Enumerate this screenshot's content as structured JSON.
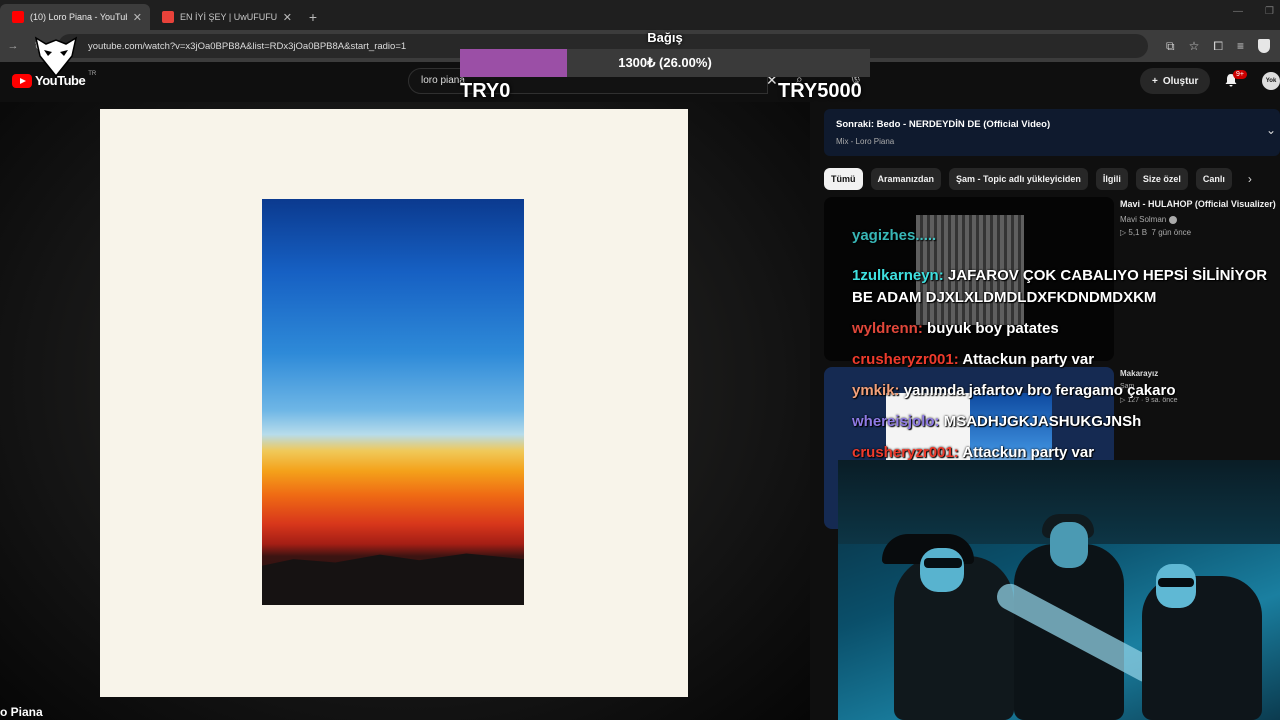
{
  "browser": {
    "tabs": [
      {
        "title": "(10) Loro Piana - YouTube",
        "active": true,
        "favicon_color": "#ff0000"
      },
      {
        "title": "EN İYİ ŞEY | UwUFUFU",
        "active": false,
        "favicon_color": "#e8423a"
      }
    ],
    "url": "youtube.com/watch?v=x3jOa0BPB8A&list=RDx3jOa0BPB8A&start_radio=1"
  },
  "youtube": {
    "logo_text": "YouTube",
    "country": "TR",
    "search_value": "loro piana",
    "create_label": "Oluştur",
    "notif_badge": "9+",
    "avatar_text": "Yok"
  },
  "donation": {
    "title": "Bağış",
    "amount_text": "1300₺ (26.00%)",
    "progress_fraction": 0.26,
    "min_label": "TRY0",
    "max_label": "TRY5000",
    "bar_color": "#9b4fa6"
  },
  "video": {
    "channel_name_partial": "o Piana"
  },
  "up_next": {
    "title": "Sonraki: Bedo - NERDEYDİN DE (Official Video)",
    "subtitle": "Mix - Loro Piana"
  },
  "chips": [
    "Tümü",
    "Aramanızdan",
    "Şam - Topic adlı yükleyiciden",
    "İlgili",
    "Size özel",
    "Canlı"
  ],
  "recommendations": [
    {
      "title": "Mavi - HULAHOP (Official Visualizer)",
      "channel": "Mavi Solman",
      "views": "▷ 5,1 B",
      "age": "7 gün önce"
    },
    {
      "title": "Makarayız",
      "channel": "Şam",
      "meta": "▷ 127 · 9 sa. önce"
    }
  ],
  "chat": [
    {
      "user": "yagizhes.....",
      "message": "",
      "color": "#41d6d6",
      "partial": true
    },
    {
      "user": "1zulkarneyn",
      "message": "JAFAROV ÇOK CABALIYO HEPSİ SİLİNİYOR BE ADAM DJXLXLDMDLDXFKDNDMDXKM",
      "color": "#3fe0e0"
    },
    {
      "user": "wyldrenn",
      "message": "buyuk boy patates",
      "color": "#e0473a"
    },
    {
      "user": "crusheryzr001",
      "message": "Attackun party var",
      "color": "#ef3b2c"
    },
    {
      "user": "ymkik",
      "message": "yanımda jafartov bro feragamo çakaro",
      "color": "#f2a07a"
    },
    {
      "user": "whereisjolo",
      "message": "MSADHJGKJASHUKGJNSh",
      "color": "#8f7be6"
    },
    {
      "user": "crusheryzr001",
      "message": "Attackun party var",
      "color": "#ef3b2c"
    }
  ]
}
